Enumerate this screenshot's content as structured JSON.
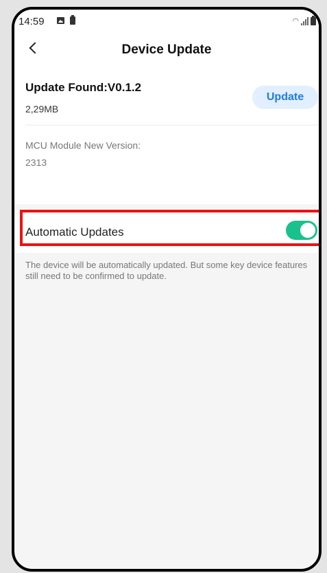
{
  "status_bar": {
    "time": "14:59",
    "left_icons": [
      "image-icon",
      "battery-icon"
    ],
    "right_icons": [
      "wifi-icon",
      "signal-icon",
      "battery-icon"
    ]
  },
  "header": {
    "back_icon": "chevron-left-icon",
    "title": "Device Update"
  },
  "update": {
    "title": "Update Found:V0.1.2",
    "size": "2,29MB",
    "button_label": "Update"
  },
  "mcu": {
    "label": "MCU Module New Version:",
    "value": "2313"
  },
  "auto_updates": {
    "label": "Automatic Updates",
    "enabled": true,
    "description": "The device will be automatically updated. But some key device features still need to be confirmed to update."
  },
  "colors": {
    "accent_blue": "#1e7bea",
    "toggle_green": "#19c28c",
    "highlight_red": "#ee1111"
  }
}
